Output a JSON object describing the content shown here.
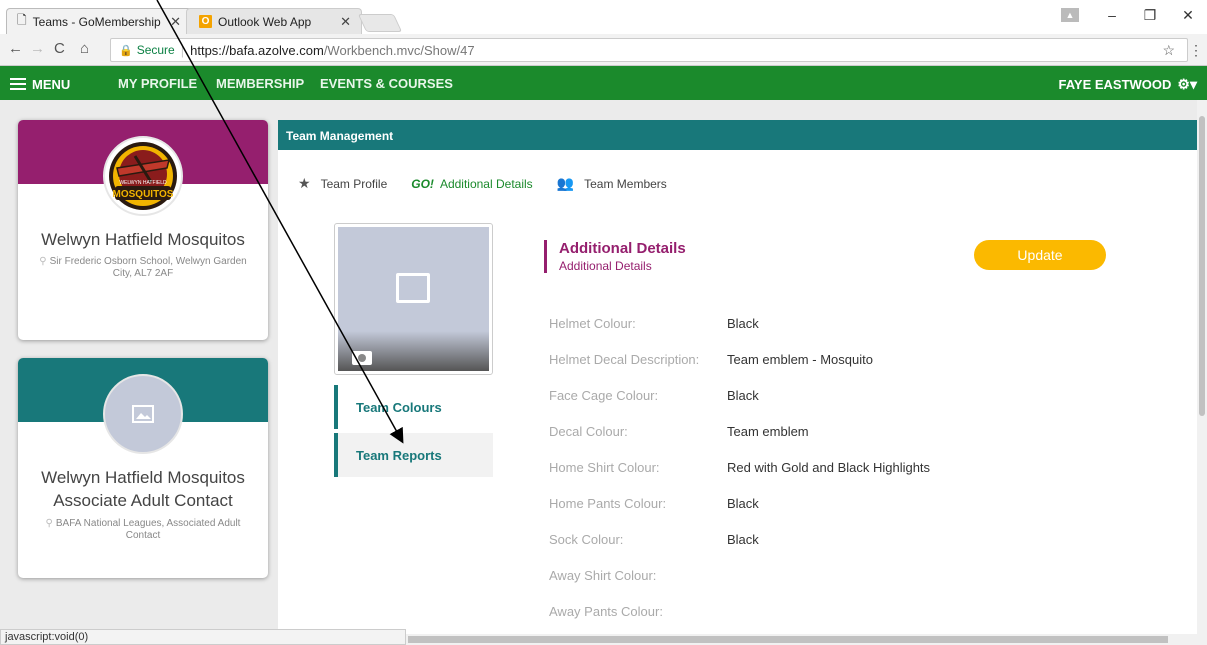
{
  "browser": {
    "tabs": [
      {
        "title": "Teams - GoMembership",
        "icon": "page-icon"
      },
      {
        "title": "Outlook Web App",
        "icon": "outlook-icon"
      }
    ],
    "secure_label": "Secure",
    "url_host": "https://bafa.azolve.com",
    "url_path": "/Workbench.mvc/Show/47",
    "status_text": "javascript:void(0)"
  },
  "topnav": {
    "menu_label": "MENU",
    "links": [
      "MY PROFILE",
      "MEMBERSHIP",
      "EVENTS & COURSES"
    ],
    "user_name": "FAYE EASTWOOD",
    "brand_color": "#1b8a2c"
  },
  "cards": [
    {
      "name": "Welwyn Hatfield Mosquitos",
      "address": "Sir Frederic Osborn School, Welwyn Garden City, AL7 2AF",
      "band_color": "#951f6e",
      "logo_text_top": "WELWYN HATFIELD",
      "logo_text_main": "MOSQUITOS"
    },
    {
      "name_line1": "Welwyn Hatfield Mosquitos",
      "name_line2": "Associate Adult Contact",
      "address": "BAFA National Leagues, Associated Adult Contact",
      "band_color": "#18787a"
    }
  ],
  "panel": {
    "header": "Team Management",
    "subnav": [
      {
        "label": "Team Profile",
        "icon": "star-icon"
      },
      {
        "label": "Additional Details",
        "icon": "go-icon",
        "icon_text": "GO!"
      },
      {
        "label": "Team Members",
        "icon": "people-icon"
      }
    ],
    "side_menu": [
      "Team Colours",
      "Team Reports"
    ],
    "section_title": "Additional Details",
    "section_subtitle": "Additional Details",
    "update_label": "Update",
    "fields": [
      {
        "label": "Helmet Colour:",
        "value": "Black"
      },
      {
        "label": "Helmet Decal Description:",
        "value": "Team emblem - Mosquito"
      },
      {
        "label": "Face Cage Colour:",
        "value": "Black"
      },
      {
        "label": "Decal Colour:",
        "value": "Team emblem"
      },
      {
        "label": "Home Shirt Colour:",
        "value": "Red with Gold and Black Highlights"
      },
      {
        "label": "Home Pants Colour:",
        "value": "Black"
      },
      {
        "label": "Sock Colour:",
        "value": "Black"
      },
      {
        "label": "Away Shirt Colour:",
        "value": ""
      },
      {
        "label": "Away Pants Colour:",
        "value": ""
      }
    ]
  }
}
